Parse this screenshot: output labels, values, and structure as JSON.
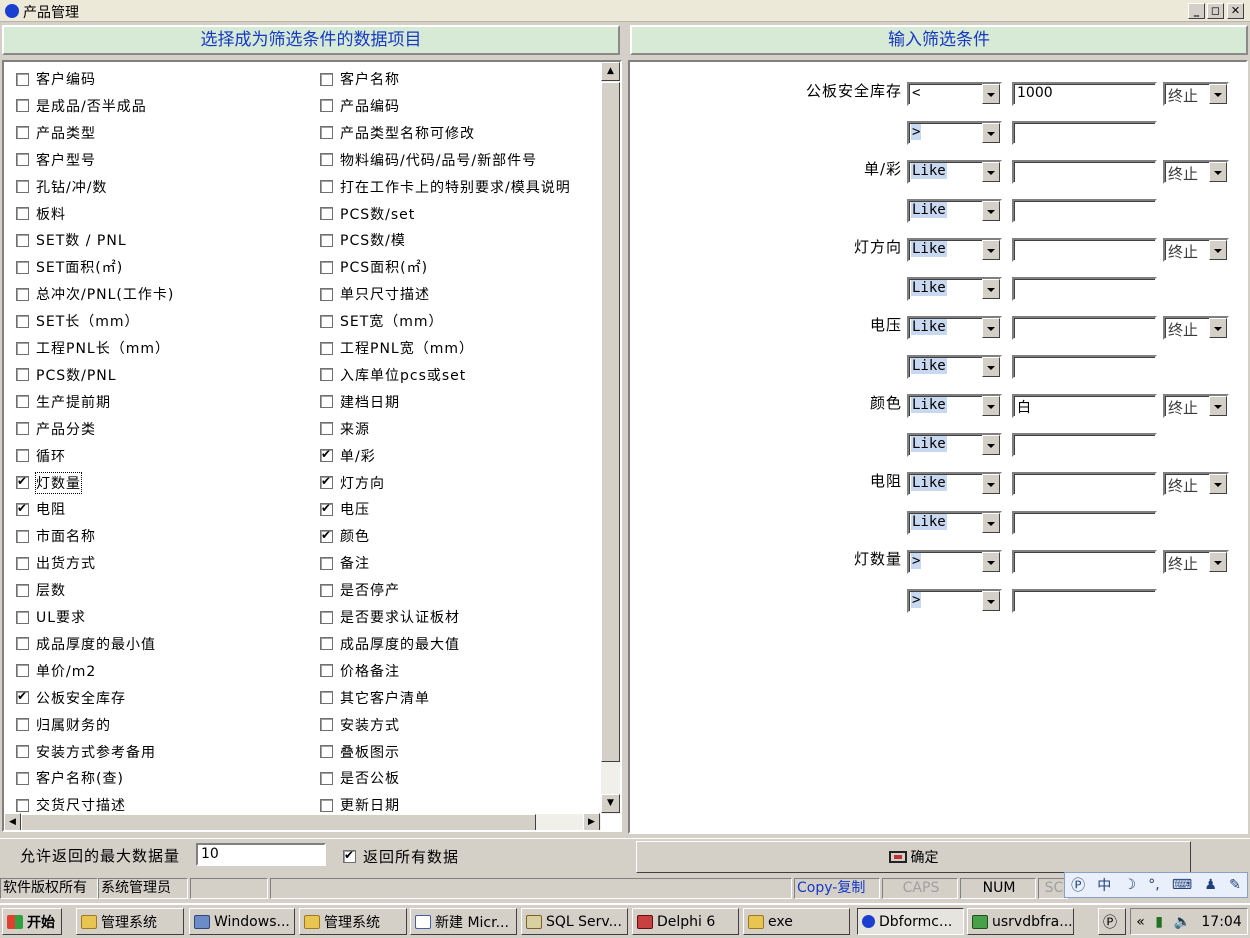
{
  "window": {
    "title": "产品管理"
  },
  "left_header": "选择成为筛选条件的数据项目",
  "right_header": "输入筛选条件",
  "fields_col1": [
    {
      "label": "客户编码",
      "checked": false
    },
    {
      "label": "是成品/否半成品",
      "checked": false
    },
    {
      "label": "产品类型",
      "checked": false
    },
    {
      "label": "客户型号",
      "checked": false
    },
    {
      "label": "孔钻/冲/数",
      "checked": false
    },
    {
      "label": "板料",
      "checked": false
    },
    {
      "label": "SET数 / PNL",
      "checked": false
    },
    {
      "label": "SET面积(㎡)",
      "checked": false
    },
    {
      "label": "总冲次/PNL(工作卡)",
      "checked": false
    },
    {
      "label": "SET长（mm）",
      "checked": false
    },
    {
      "label": "工程PNL长（mm）",
      "checked": false
    },
    {
      "label": "PCS数/PNL",
      "checked": false
    },
    {
      "label": "生产提前期",
      "checked": false
    },
    {
      "label": "产品分类",
      "checked": false
    },
    {
      "label": "循环",
      "checked": false
    },
    {
      "label": "灯数量",
      "checked": true,
      "focused": true
    },
    {
      "label": "电阻",
      "checked": true
    },
    {
      "label": "市面名称",
      "checked": false
    },
    {
      "label": "出货方式",
      "checked": false
    },
    {
      "label": "层数",
      "checked": false
    },
    {
      "label": "UL要求",
      "checked": false
    },
    {
      "label": "成品厚度的最小值",
      "checked": false
    },
    {
      "label": "单价/m2",
      "checked": false
    },
    {
      "label": "公板安全库存",
      "checked": true
    },
    {
      "label": "归属财务的",
      "checked": false
    },
    {
      "label": "安装方式参考备用",
      "checked": false
    },
    {
      "label": "客户名称(查)",
      "checked": false
    },
    {
      "label": "交货尺寸描述",
      "checked": false
    }
  ],
  "fields_col2": [
    {
      "label": "客户名称",
      "checked": false
    },
    {
      "label": "产品编码",
      "checked": false
    },
    {
      "label": "产品类型名称可修改",
      "checked": false
    },
    {
      "label": "物料编码/代码/品号/新部件号",
      "checked": false
    },
    {
      "label": "打在工作卡上的特别要求/模具说明",
      "checked": false
    },
    {
      "label": "PCS数/set",
      "checked": false
    },
    {
      "label": "PCS数/模",
      "checked": false
    },
    {
      "label": "PCS面积(㎡)",
      "checked": false
    },
    {
      "label": "单只尺寸描述",
      "checked": false
    },
    {
      "label": "SET宽（mm）",
      "checked": false
    },
    {
      "label": "工程PNL宽（mm）",
      "checked": false
    },
    {
      "label": "入库单位pcs或set",
      "checked": false
    },
    {
      "label": "建档日期",
      "checked": false
    },
    {
      "label": "来源",
      "checked": false
    },
    {
      "label": "单/彩",
      "checked": true
    },
    {
      "label": "灯方向",
      "checked": true
    },
    {
      "label": "电压",
      "checked": true
    },
    {
      "label": "颜色",
      "checked": true
    },
    {
      "label": "备注",
      "checked": false
    },
    {
      "label": "是否停产",
      "checked": false
    },
    {
      "label": "是否要求认证板材",
      "checked": false
    },
    {
      "label": "成品厚度的最大值",
      "checked": false
    },
    {
      "label": "价格备注",
      "checked": false
    },
    {
      "label": "其它客户清单",
      "checked": false
    },
    {
      "label": "安装方式",
      "checked": false
    },
    {
      "label": "叠板图示",
      "checked": false
    },
    {
      "label": "是否公板",
      "checked": false
    },
    {
      "label": "更新日期",
      "checked": false
    }
  ],
  "filters": [
    {
      "label": "公板安全库存",
      "op1": "<",
      "val1": "1000",
      "logic": "终止",
      "op2": ">",
      "val2": "",
      "op1_selected": false
    },
    {
      "label": "单/彩",
      "op1": "Like",
      "val1": "",
      "logic": "终止",
      "op2": "Like",
      "val2": "",
      "op1_selected": true
    },
    {
      "label": "灯方向",
      "op1": "Like",
      "val1": "",
      "logic": "终止",
      "op2": "Like",
      "val2": "",
      "op1_selected": true
    },
    {
      "label": "电压",
      "op1": "Like",
      "val1": "",
      "logic": "终止",
      "op2": "Like",
      "val2": "",
      "op1_selected": true
    },
    {
      "label": "颜色",
      "op1": "Like",
      "val1": "白",
      "logic": "终止",
      "op2": "Like",
      "val2": "",
      "op1_selected": true
    },
    {
      "label": "电阻",
      "op1": "Like",
      "val1": "",
      "logic": "终止",
      "op2": "Like",
      "val2": "",
      "op1_selected": true
    },
    {
      "label": "灯数量",
      "op1": ">",
      "val1": "",
      "logic": "终止",
      "op2": ">",
      "val2": "",
      "op1_selected": true
    }
  ],
  "bottom": {
    "max_label": "允许返回的最大数据量",
    "max_value": "10",
    "return_all_label": "返回所有数据",
    "return_all_checked": true,
    "ok_label": "确定"
  },
  "status": {
    "copyright": "软件版权所有",
    "user": "系统管理员",
    "copy": "Copy-复制",
    "caps": "CAPS",
    "num": "NUM",
    "scrl": "SC"
  },
  "ime": {
    "mode": "中"
  },
  "taskbar": {
    "start": "开始",
    "items": [
      "管理系统",
      "Windows...",
      "管理系统",
      "新建 Micr...",
      "SQL Serv...",
      "Delphi 6",
      "exe",
      "Dbformc...",
      "usrvdbfra..."
    ],
    "clock": "17:04"
  }
}
